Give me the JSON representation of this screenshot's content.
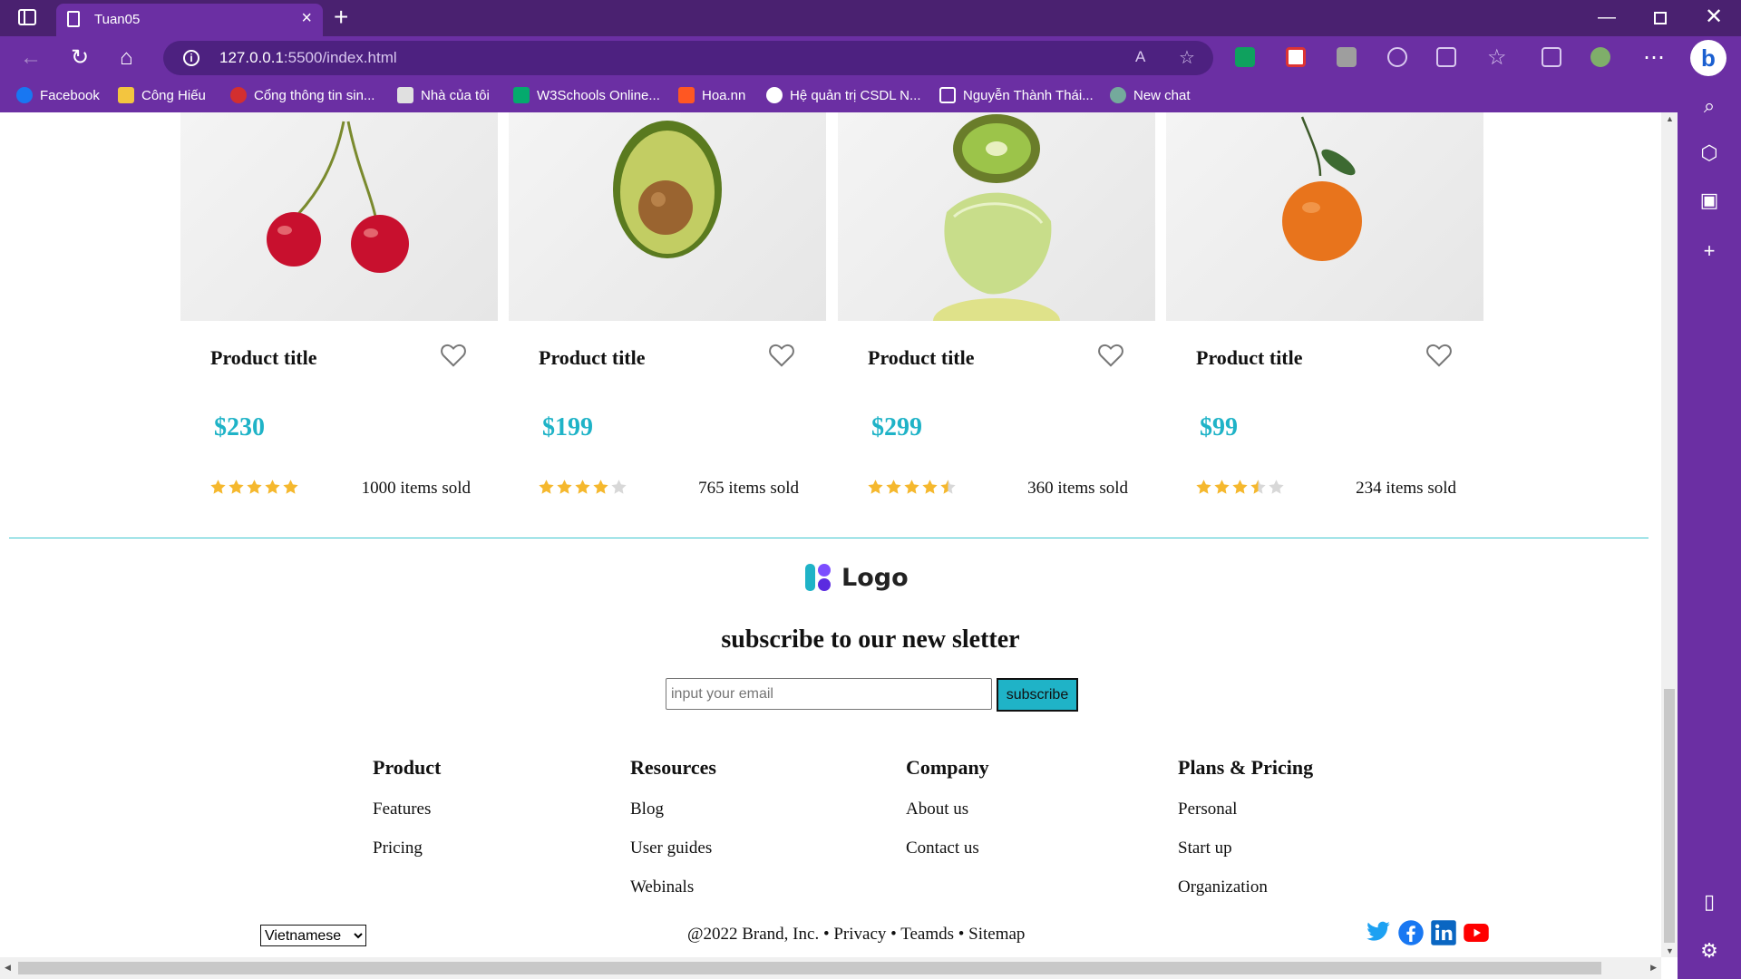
{
  "browser": {
    "tab_title": "Tuan05",
    "url_host": "127.0.0.1",
    "url_path": ":5500/index.html",
    "theme_color": "#6b2fa3"
  },
  "bookmarks": [
    {
      "label": "Facebook",
      "icon": "facebook-icon",
      "color": "#1877f2"
    },
    {
      "label": "Công Hiếu",
      "icon": "folder-icon",
      "color": "#f3c53f"
    },
    {
      "label": "Cổng thông tin sin...",
      "icon": "portal-icon",
      "color": "#d32f2f"
    },
    {
      "label": "Nhà của tôi",
      "icon": "home-page-icon",
      "color": "#e0e0e0"
    },
    {
      "label": "W3Schools Online...",
      "icon": "w3schools-icon",
      "color": "#04aa6d"
    },
    {
      "label": "Hoa.nn",
      "icon": "blogger-icon",
      "color": "#ff5722"
    },
    {
      "label": "Hệ quản trị CSDL N...",
      "icon": "wordpress-icon",
      "color": "#ffffff"
    },
    {
      "label": "Nguyễn Thành Thái...",
      "icon": "page-icon",
      "color": "#ffffff"
    },
    {
      "label": "New chat",
      "icon": "chatgpt-icon",
      "color": "#74aa9c"
    }
  ],
  "products": [
    {
      "title": "Product title",
      "price": "$230",
      "rating": 5,
      "sold": "1000 items sold",
      "image": "cherry"
    },
    {
      "title": "Product title",
      "price": "$199",
      "rating": 4,
      "sold": "765 items sold",
      "image": "avocado"
    },
    {
      "title": "Product title",
      "price": "$299",
      "rating": 4.5,
      "sold": "360 items sold",
      "image": "kiwi-lime"
    },
    {
      "title": "Product title",
      "price": "$99",
      "rating": 3.5,
      "sold": "234 items sold",
      "image": "orange"
    }
  ],
  "footer": {
    "logo_text": "Logo",
    "newsletter_title": "subscribe to our new sletter",
    "email_placeholder": "input your email",
    "subscribe_label": "subscribe",
    "columns": [
      {
        "heading": "Product",
        "links": [
          "Features",
          "Pricing"
        ]
      },
      {
        "heading": "Resources",
        "links": [
          "Blog",
          "User guides",
          "Webinals"
        ]
      },
      {
        "heading": "Company",
        "links": [
          "About us",
          "Contact us"
        ]
      },
      {
        "heading": "Plans & Pricing",
        "links": [
          "Personal",
          "Start up",
          "Organization"
        ]
      }
    ],
    "language": "Vietnamese",
    "copyright": "@2022 Brand, Inc. • Privacy • Teamds • Sitemap",
    "social": [
      "twitter-icon",
      "facebook-icon",
      "linkedin-icon",
      "youtube-icon"
    ],
    "accent_color": "#1fb3c7"
  }
}
